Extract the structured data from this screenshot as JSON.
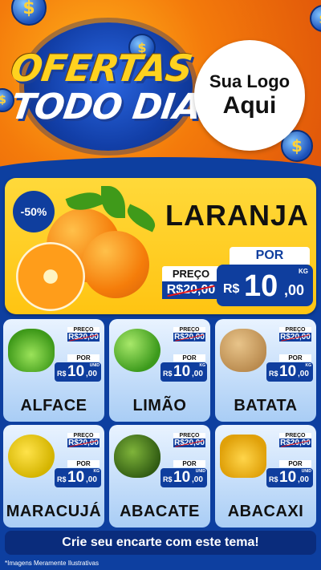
{
  "header": {
    "title_line1": "OFERTAS",
    "title_line2": "TODO DIA",
    "logo_line1": "Sua Logo",
    "logo_line2": "Aqui"
  },
  "featured": {
    "discount_badge": "-50%",
    "name": "LARANJA",
    "preco_label": "PREÇO",
    "old_price": "R$20,00",
    "por_label": "POR",
    "currency": "R$",
    "price_int": "10",
    "price_dec": ",00",
    "unit": "KG"
  },
  "products": [
    {
      "name": "ALFACE",
      "icon": "lettuce-icon",
      "preco_label": "PREÇO",
      "old_price": "R$20,00",
      "por_label": "POR",
      "currency": "R$",
      "price_int": "10",
      "price_dec": ",00",
      "unit": "UNID"
    },
    {
      "name": "LIMÃO",
      "icon": "lime-icon",
      "preco_label": "PREÇO",
      "old_price": "R$20,00",
      "por_label": "POR",
      "currency": "R$",
      "price_int": "10",
      "price_dec": ",00",
      "unit": "KG"
    },
    {
      "name": "BATATA",
      "icon": "potato-icon",
      "preco_label": "PREÇO",
      "old_price": "R$20,00",
      "por_label": "POR",
      "currency": "R$",
      "price_int": "10",
      "price_dec": ",00",
      "unit": "KG"
    },
    {
      "name": "MARACUJÁ",
      "icon": "passion-fruit-icon",
      "preco_label": "PREÇO",
      "old_price": "R$20,00",
      "por_label": "POR",
      "currency": "R$",
      "price_int": "10",
      "price_dec": ",00",
      "unit": "KG"
    },
    {
      "name": "ABACATE",
      "icon": "avocado-icon",
      "preco_label": "PREÇO",
      "old_price": "R$20,00",
      "por_label": "POR",
      "currency": "R$",
      "price_int": "10",
      "price_dec": ",00",
      "unit": "UNID"
    },
    {
      "name": "ABACAXI",
      "icon": "pineapple-icon",
      "preco_label": "PREÇO",
      "old_price": "R$20,00",
      "por_label": "POR",
      "currency": "R$",
      "price_int": "10",
      "price_dec": ",00",
      "unit": "UNID"
    }
  ],
  "cta": "Crie seu encarte com este tema!",
  "disclaimer": "*Imagens Meramente Ilustrativas",
  "colors": {
    "brand_blue": "#0f3e9e",
    "accent_yellow": "#ffd21f",
    "header_orange": "#f47b0b",
    "strike_red": "#e3151a"
  }
}
